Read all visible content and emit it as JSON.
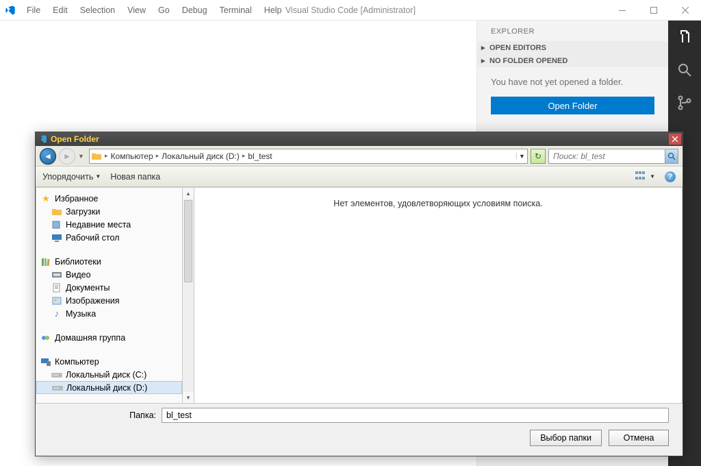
{
  "window": {
    "title": "Visual Studio Code [Administrator]"
  },
  "menubar": [
    "File",
    "Edit",
    "Selection",
    "View",
    "Go",
    "Debug",
    "Terminal",
    "Help"
  ],
  "explorer": {
    "title": "EXPLORER",
    "sections": {
      "open_editors": "OPEN EDITORS",
      "no_folder": "NO FOLDER OPENED"
    },
    "no_folder_msg": "You have not yet opened a folder.",
    "open_folder_btn": "Open Folder"
  },
  "dialog": {
    "title": "Open Folder",
    "breadcrumb": [
      "Компьютер",
      "Локальный диск (D:)",
      "bl_test"
    ],
    "search_placeholder": "Поиск: bl_test",
    "toolbar": {
      "organize": "Упорядочить",
      "new_folder": "Новая папка"
    },
    "tree": {
      "favorites": "Избранное",
      "downloads": "Загрузки",
      "recent": "Недавние места",
      "desktop": "Рабочий стол",
      "libraries": "Библиотеки",
      "video": "Видео",
      "documents": "Документы",
      "images": "Изображения",
      "music": "Музыка",
      "homegroup": "Домашняя группа",
      "computer": "Компьютер",
      "drive_c": "Локальный диск (C:)",
      "drive_d": "Локальный диск (D:)"
    },
    "content_empty": "Нет элементов, удовлетворяющих условиям поиска.",
    "footer": {
      "folder_label": "Папка:",
      "folder_value": "bl_test",
      "select_btn": "Выбор папки",
      "cancel_btn": "Отмена"
    }
  }
}
